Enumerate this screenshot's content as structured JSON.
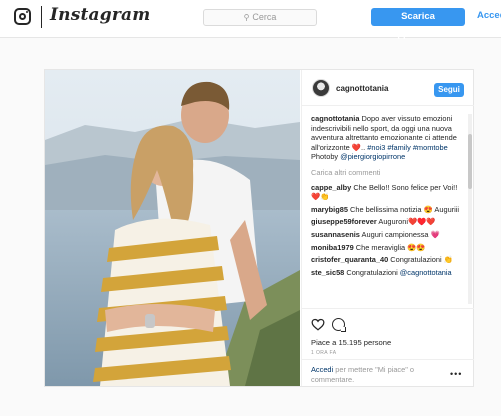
{
  "nav": {
    "wordmark": "Instagram",
    "search_placeholder": "Cerca",
    "cta_label": "Scarica l'applicazione",
    "login_label": "Accedi"
  },
  "post": {
    "username": "cagnottotania",
    "follow_label": "Segui",
    "caption_user": "cagnottotania",
    "caption_text": "Dopo aver vissuto emozioni indescrivibili nello sport, da oggi una nuova avventura altrettanto emozionante ci attende all'orizzonte ❤️..",
    "caption_tags": "#noi3 #family #momtobe",
    "photo_credit_prefix": "Photoby",
    "photo_credit_handle": "@piergiorgiopirrone",
    "load_more": "Carica altri commenti",
    "comments": [
      {
        "user": "cappe_alby",
        "text": "Che Bello!! Sono felice per Voi!! ❤️👏"
      },
      {
        "user": "marybig85",
        "text": "Che bellissima notizia 😍 Auguriii"
      },
      {
        "user": "giuseppe59forever",
        "text": "Auguroni❤️♥️❤️"
      },
      {
        "user": "susannasenis",
        "text": "Auguri campionessa 💗"
      },
      {
        "user": "moniba1979",
        "text": "Che meraviglia 😍😍"
      },
      {
        "user": "cristofer_quaranta_40",
        "text": "Congratulazioni 👏"
      },
      {
        "user": "ste_sic58",
        "text": "Congratulazioni",
        "mention": "@cagnottotania"
      }
    ],
    "likes_text": "Piace a 15.195 persone",
    "time_ago": "1 ORA FA",
    "add_comment_link": "Accedi",
    "add_comment_text": "per mettere \"Mi piace\" o commentare.",
    "more_label": "•••"
  },
  "colors": {
    "accent": "#3897f0",
    "link": "#003569",
    "heart_badge": "#ed4956"
  }
}
